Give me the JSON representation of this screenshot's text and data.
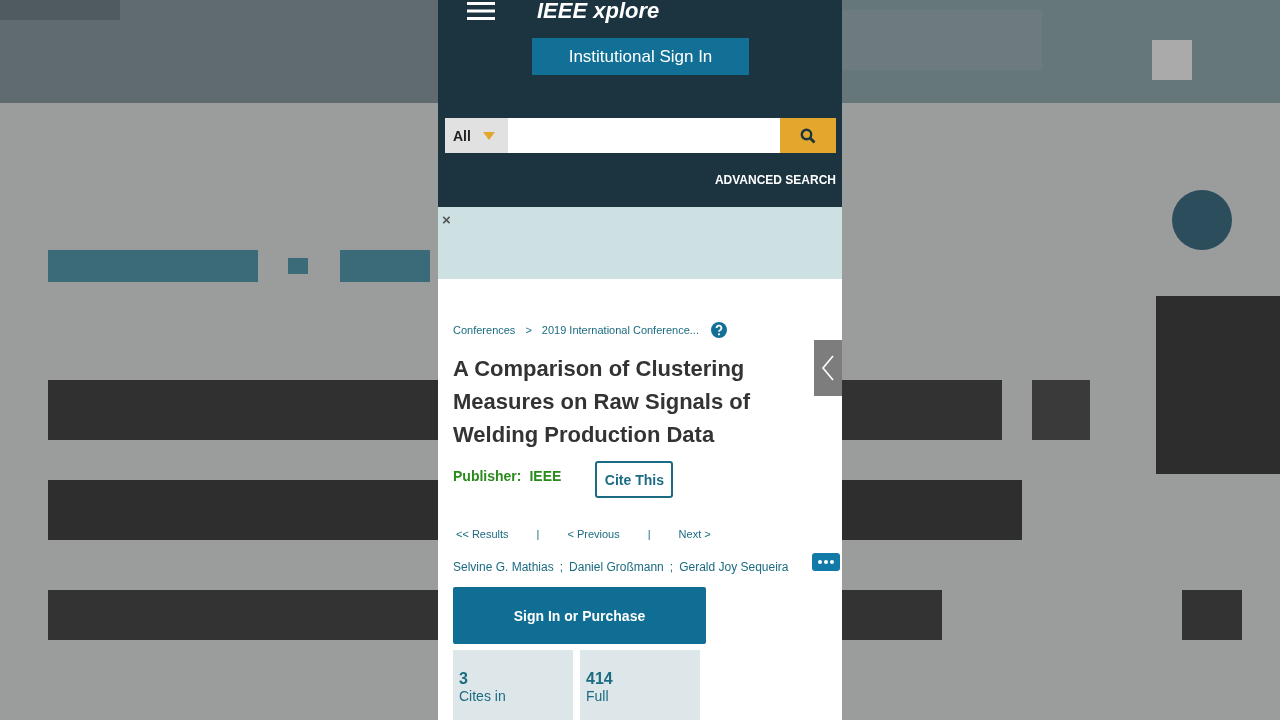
{
  "header": {
    "logo": "IEEE xplore",
    "sign_in": "Institutional Sign In",
    "search": {
      "scope": "All"
    },
    "advanced_search": "ADVANCED SEARCH"
  },
  "banner": {
    "close": "×"
  },
  "breadcrumbs": [
    "Conferences",
    ">",
    "2019 International Conference..."
  ],
  "title": "A Comparison of Clustering Measures on Raw Signals of Welding Production Data",
  "publisher": {
    "label": "Publisher:",
    "value": "IEEE"
  },
  "cite": "Cite This",
  "nav": [
    "<< Results",
    "|",
    "< Previous",
    "|",
    "Next >"
  ],
  "authors": [
    "Selvine G. Mathias",
    ";",
    "Daniel Großmann",
    ";",
    "Gerald Joy Sequeira"
  ],
  "purchase": "Sign In or Purchase",
  "metrics": [
    {
      "value": "3",
      "label": "Cites in"
    },
    {
      "value": "414",
      "label": "Full"
    }
  ]
}
